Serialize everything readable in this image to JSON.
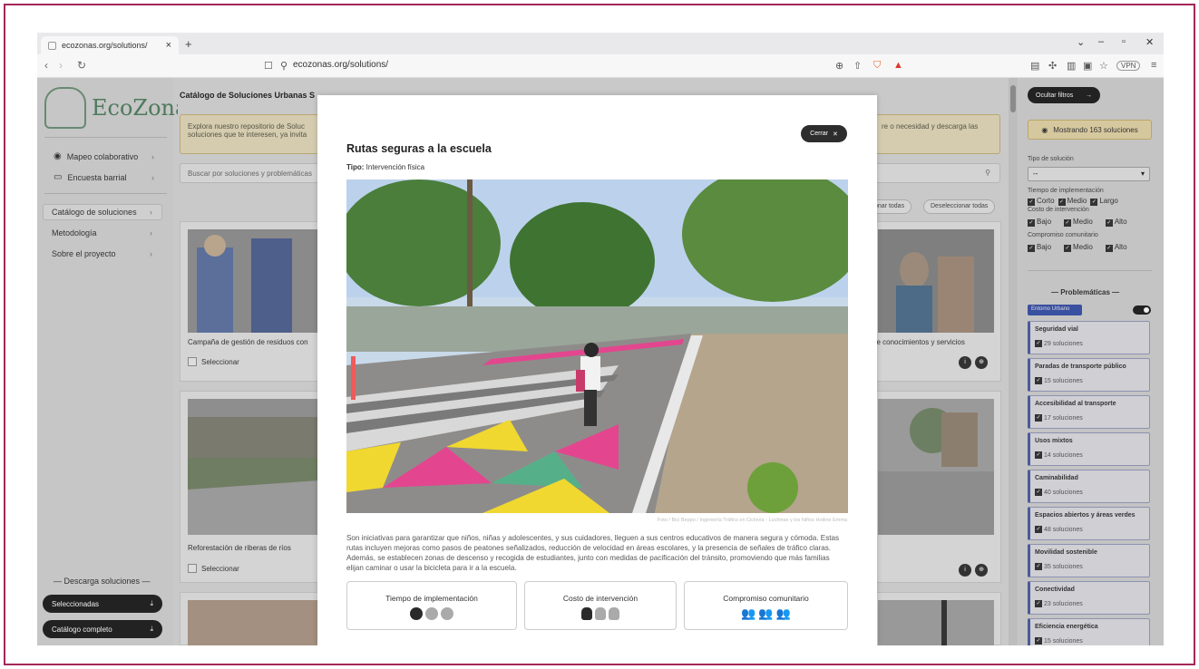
{
  "browser": {
    "tab_title": "ecozonas.org/solutions/",
    "url": "ecozonas.org/solutions/",
    "vpn_label": "VPN"
  },
  "sidebar": {
    "logo_text": "EcoZonas",
    "nav": [
      {
        "label": "Mapeo colaborativo",
        "icon": "map-pin-icon"
      },
      {
        "label": "Encuesta barrial",
        "icon": "chat-icon"
      },
      {
        "label": "Catálogo de soluciones",
        "icon": ""
      },
      {
        "label": "Metodología",
        "icon": ""
      },
      {
        "label": "Sobre el proyecto",
        "icon": ""
      }
    ],
    "download_title": "— Descarga soluciones —",
    "download_selected": "Seleccionadas",
    "download_all": "Catálogo completo"
  },
  "catalog": {
    "title": "Catálogo de Soluciones Urbanas S",
    "banner_left": "Explora nuestro repositorio de Soluc soluciones que te interesen, ya invita",
    "banner_right": "re o necesidad y descarga las",
    "search_placeholder": "Buscar por soluciones y problemáticas",
    "select_all": "onar todas",
    "deselect_all": "Deseleccionar todas",
    "cards": [
      {
        "label": "Campaña de gestión de residuos con",
        "check": "Seleccionar"
      },
      {
        "label": "Reforestación de riberas de ríos",
        "check": "Seleccionar"
      },
      {
        "label": "de conocimientos y servicios",
        "check": ""
      }
    ]
  },
  "filters": {
    "hide_button": "Ocultar filtros",
    "showing": "Mostrando 163 soluciones",
    "type_label": "Tipo de solución",
    "type_value": "--",
    "time_label": "Tiempo de implementación",
    "time_opts": [
      "Corto",
      "Medio",
      "Largo"
    ],
    "cost_label": "Costo de intervención",
    "cost_opts": [
      "Bajo",
      "Medio",
      "Alto"
    ],
    "commit_label": "Compromiso comunitario",
    "commit_opts": [
      "Bajo",
      "Medio",
      "Alto"
    ],
    "problems_title": "— Problemáticas —",
    "chip": "Entorno Urbano",
    "problems": [
      {
        "name": "Seguridad vial",
        "count": "29 soluciones"
      },
      {
        "name": "Paradas de transporte público",
        "count": "15 soluciones"
      },
      {
        "name": "Accesibilidad al transporte",
        "count": "17 soluciones"
      },
      {
        "name": "Usos mixtos",
        "count": "14 soluciones"
      },
      {
        "name": "Caminabilidad",
        "count": "40 soluciones"
      },
      {
        "name": "Espacios abiertos y áreas verdes",
        "count": "48 soluciones"
      },
      {
        "name": "Movilidad sostenible",
        "count": "35 soluciones"
      },
      {
        "name": "Conectividad",
        "count": "23 soluciones"
      },
      {
        "name": "Eficiencia energética",
        "count": "15 soluciones"
      }
    ]
  },
  "modal": {
    "close_label": "Cerrar",
    "title": "Rutas seguras a la escuela",
    "type_key": "Tipo:",
    "type_value": "Intervención física",
    "photo_credit": "Foto / Bici Beppo / Ingeniería Tráfico en Ciclovía - Luchinas y los Niños Hotline Emma",
    "description": "Son iniciativas para garantizar que niños, niñas y adolescentes, y sus cuidadores, lleguen a sus centros educativos de manera segura y cómoda. Estas rutas incluyen mejoras como pasos de peatones señalizados, reducción de velocidad en áreas escolares, y la presencia de señales de tráfico claras. Además, se establecen zonas de descenso y recogida de estudiantes, junto con medidas de pacificación del tránsito, promoviendo que más familias elijan caminar o usar la bicicleta para ir a la escuela.",
    "metrics": [
      {
        "label": "Tiempo de implementación",
        "level": 1,
        "of": 3,
        "icon": "clock-icon"
      },
      {
        "label": "Costo de intervención",
        "level": 1,
        "of": 3,
        "icon": "money-bag-icon"
      },
      {
        "label": "Compromiso comunitario",
        "level": 3,
        "of": 3,
        "icon": "people-icon"
      }
    ]
  }
}
